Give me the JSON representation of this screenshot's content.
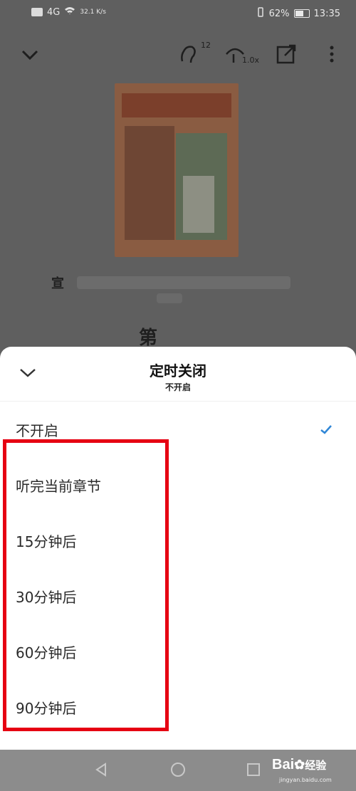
{
  "status_bar": {
    "network": "4G",
    "speed": "32.1 K/s",
    "battery": "62%",
    "time": "13:35"
  },
  "player": {
    "listen_count": "12",
    "speed": "1.0x"
  },
  "book": {
    "title_first_char": "宣",
    "chapter_partial": "第"
  },
  "sheet": {
    "title": "定时关闭",
    "subtitle": "不开启",
    "options": [
      {
        "label": "不开启",
        "selected": true
      },
      {
        "label": "听完当前章节",
        "selected": false
      },
      {
        "label": "15分钟后",
        "selected": false
      },
      {
        "label": "30分钟后",
        "selected": false
      },
      {
        "label": "60分钟后",
        "selected": false
      },
      {
        "label": "90分钟后",
        "selected": false
      }
    ]
  },
  "watermark": {
    "main": "Bai",
    "main2": "经验",
    "sub": "jingyan.baidu.com"
  },
  "colors": {
    "accent": "#2f86d6",
    "highlight": "#e60012",
    "overlay": "#5f5f5f"
  }
}
